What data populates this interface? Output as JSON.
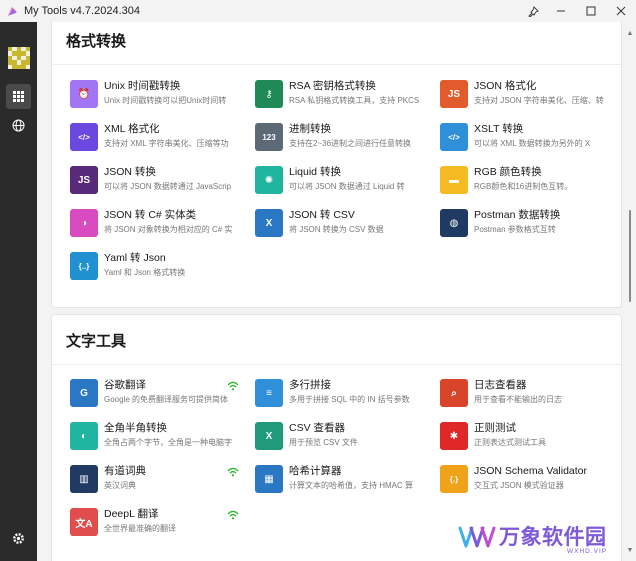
{
  "titlebar": {
    "title": "My Tools v4.7.2024.304"
  },
  "sections": [
    {
      "title": "格式转换",
      "tools": [
        {
          "name": "Unix 时间戳转换",
          "desc": "Unix 时间戳转换可以把Unix时间转",
          "icon": "alarm-clock-icon",
          "color": "#a275f5",
          "glyph": "⏰"
        },
        {
          "name": "RSA 密钥格式转换",
          "desc": "RSA 私钥格式转换工具，支持 PKCS",
          "icon": "key-icon",
          "color": "#1f8a55",
          "glyph": "⚷"
        },
        {
          "name": "JSON 格式化",
          "desc": "支持对 JSON 字符串美化、压缩、转",
          "icon": "json-file-icon",
          "color": "#e25b2c",
          "glyph": "JS"
        },
        {
          "name": "XML 格式化",
          "desc": "支持对 XML 字符串美化、压缩等功",
          "icon": "code-icon",
          "color": "#6b49e0",
          "glyph": "</>"
        },
        {
          "name": "进制转换",
          "desc": "支持在2~36进制之间进行任意转换",
          "icon": "number-123-icon",
          "color": "#5c6a78",
          "glyph": "123"
        },
        {
          "name": "XSLT 转换",
          "desc": "可以将 XML 数据转换为另外的 X",
          "icon": "code-icon",
          "color": "#2f8fd8",
          "glyph": "</>"
        },
        {
          "name": "JSON 转换",
          "desc": "可以将 JSON 数据转通过 JavaScrip",
          "icon": "json-file-icon",
          "color": "#5a2a7a",
          "glyph": "JS"
        },
        {
          "name": "Liquid 转换",
          "desc": "可以将 JSON 数据通过 Liquid 转",
          "icon": "sparkle-icon",
          "color": "#1fb5a0",
          "glyph": "✺"
        },
        {
          "name": "RGB 颜色转换",
          "desc": "RGB颜色和16进制色互转。",
          "icon": "palette-icon",
          "color": "#f5b921",
          "glyph": "▬"
        },
        {
          "name": "JSON 转 C# 实体类",
          "desc": "将 JSON 对象转换为相对应的 C# 实",
          "icon": "csharp-icon",
          "color": "#d94bc1",
          "glyph": "◑"
        },
        {
          "name": "JSON 转 CSV",
          "desc": "将 JSON 转换为 CSV 数据",
          "icon": "excel-icon",
          "color": "#2a77c4",
          "glyph": "X"
        },
        {
          "name": "Postman 数据转换",
          "desc": "Postman 参数格式互转",
          "icon": "globe-icon",
          "color": "#1f3b63",
          "glyph": "◍"
        },
        {
          "name": "Yaml 转 Json",
          "desc": "Yaml 和 Json 格式转换",
          "icon": "braces-icon",
          "color": "#2090d0",
          "glyph": "{..}"
        }
      ]
    },
    {
      "title": "文字工具",
      "tools": [
        {
          "name": "谷歌翻译",
          "desc": "Google 的免费翻译服务可提供简体",
          "icon": "translate-icon",
          "color": "#2a77c4",
          "glyph": "G",
          "wifi": true
        },
        {
          "name": "多行拼接",
          "desc": "多用于拼接 SQL 中的 IN 括号参数",
          "icon": "list-icon",
          "color": "#2f8fd8",
          "glyph": "≡"
        },
        {
          "name": "日志查看器",
          "desc": "用于查看不能输出的日志",
          "icon": "search-icon",
          "color": "#d9452a",
          "glyph": "⌕"
        },
        {
          "name": "全角半角转换",
          "desc": "全角占两个字节，全角是一种电脑字",
          "icon": "half-circle-icon",
          "color": "#1fb5a0",
          "glyph": "◐"
        },
        {
          "name": "CSV 查看器",
          "desc": "用于预览 CSV 文件",
          "icon": "excel-icon",
          "color": "#1f9a7a",
          "glyph": "X"
        },
        {
          "name": "正则测试",
          "desc": "正则表达式测试工具",
          "icon": "asterisk-icon",
          "color": "#e02828",
          "glyph": "✱"
        },
        {
          "name": "有道词典",
          "desc": "英汉词典",
          "icon": "books-icon",
          "color": "#203a63",
          "glyph": "▥",
          "wifi": true
        },
        {
          "name": "哈希计算器",
          "desc": "计算文本的哈希值，支持 HMAC 算",
          "icon": "calculator-icon",
          "color": "#2a77c4",
          "glyph": "▦"
        },
        {
          "name": "JSON Schema Validator",
          "desc": "交互式 JSON 模式验证器",
          "icon": "braces-icon",
          "color": "#f0a21a",
          "glyph": "{.}"
        },
        {
          "name": "DeepL 翻译",
          "desc": "全世界最准确的翻译",
          "icon": "translate-icon",
          "color": "#e14c4c",
          "glyph": "文A",
          "wifi": true
        }
      ]
    }
  ],
  "watermark": {
    "text": "万象软件园",
    "sub": "WXHD.VIP"
  }
}
